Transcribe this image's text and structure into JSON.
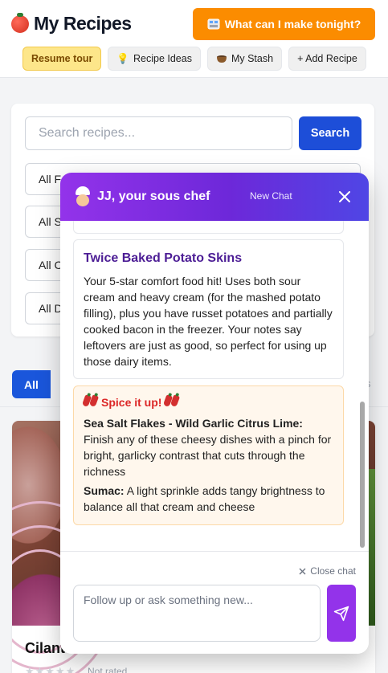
{
  "header": {
    "app_title": "My Recipes",
    "tonight_button": "What can I make tonight?",
    "nav": {
      "resume_tour": "Resume tour",
      "recipe_ideas": "Recipe Ideas",
      "my_stash": "My Stash",
      "add_recipe": "+ Add Recipe"
    }
  },
  "search": {
    "placeholder": "Search recipes...",
    "button": "Search",
    "filters": [
      "All F",
      "All S",
      "All C",
      "All D"
    ]
  },
  "tabs": {
    "active": "All",
    "hint": "s"
  },
  "recipe_card": {
    "name": "Cilant",
    "stars": "★★★★★",
    "rating_text": "Not rated"
  },
  "chat": {
    "title": "JJ, your sous chef",
    "new_chat": "New Chat",
    "message": {
      "title": "Twice Baked Potato Skins",
      "text": "Your 5-star comfort food hit! Uses both sour cream and heavy cream (for the mashed potato filling), plus you have russet potatoes and partially cooked bacon in the freezer. Your notes say leftovers are just as good, so perfect for using up those dairy items."
    },
    "spice": {
      "title": "Spice it up!",
      "items": [
        {
          "name": "Sea Salt Flakes - Wild Garlic Citrus Lime:",
          "text": "Finish any of these cheesy dishes with a pinch for bright, garlicky contrast that cuts through the richness"
        },
        {
          "name": "Sumac:",
          "text": "A light sprinkle adds tangy brightness to balance all that cream and cheese"
        }
      ]
    },
    "close_chat": "Close chat",
    "input_placeholder": "Follow up or ask something new..."
  },
  "colors": {
    "orange": "#fb8c00",
    "blue": "#1d4ed8",
    "purple": "#9333ea",
    "spice_red": "#dc2626"
  }
}
